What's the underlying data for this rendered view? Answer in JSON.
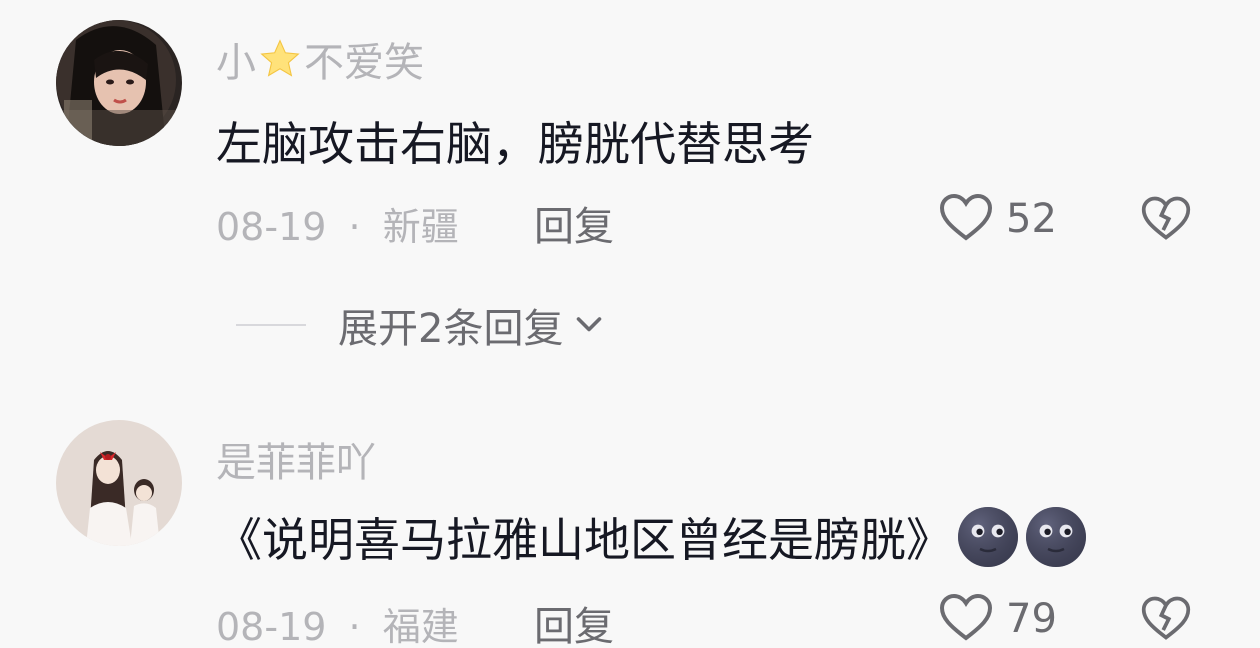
{
  "comments": [
    {
      "username_prefix": "小",
      "username_star": "star-emoji",
      "username_suffix": "不爱笑",
      "text": "左脑攻击右脑，膀胱代替思考",
      "date": "08-19",
      "separator": "·",
      "location": "新疆",
      "reply_label": "回复",
      "like_count": "52"
    },
    {
      "username": "是菲菲吖",
      "text": "《说明喜马拉雅山地区曾经是膀胱》",
      "emoji": "new-moon-face-emoji",
      "date": "08-19",
      "separator": "·",
      "location": "福建",
      "reply_label": "回复",
      "like_count": "79"
    }
  ],
  "expand_replies": {
    "label": "展开2条回复"
  },
  "colors": {
    "background": "#f8f8f8",
    "text_primary": "#161823",
    "text_secondary": "#b4b4b8",
    "text_action": "#6b6b70"
  }
}
